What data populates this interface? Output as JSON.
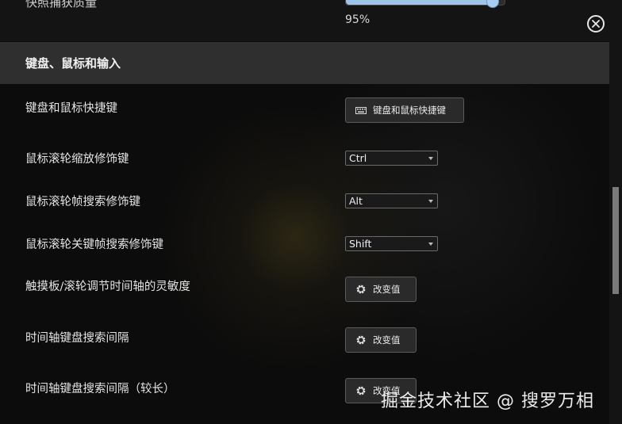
{
  "top": {
    "label": "快照捕获质量",
    "quality_value": "95%",
    "quality_fraction": 0.95
  },
  "section": {
    "title": "键盘、鼠标和输入"
  },
  "rows": {
    "shortcuts": {
      "label": "键盘和鼠标快捷键",
      "button": "键盘和鼠标快捷键"
    },
    "zoom_modifier": {
      "label": "鼠标滚轮缩放修饰键",
      "value": "Ctrl"
    },
    "frame_modifier": {
      "label": "鼠标滚轮帧搜索修饰键",
      "value": "Alt"
    },
    "keyframe_modifier": {
      "label": "鼠标滚轮关键帧搜索修饰键",
      "value": "Shift"
    },
    "sensitivity": {
      "label": "触摸板/滚轮调节时间轴的灵敏度",
      "button": "改变值"
    },
    "seek_interval": {
      "label": "时间轴键盘搜索间隔",
      "button": "改变值"
    },
    "seek_interval_long": {
      "label": "时间轴键盘搜索间隔（较长）",
      "button": "改变值"
    }
  },
  "watermark": "掘金技术社区 @ 搜罗万相",
  "icons": {
    "close": "close-circle-icon",
    "keyboard": "keyboard-icon",
    "gear": "gear-icon"
  },
  "colors": {
    "slider_fill": "#9fc4ea",
    "section_bg": "#2f2f2f",
    "page_bg": "#0c0c0c"
  }
}
